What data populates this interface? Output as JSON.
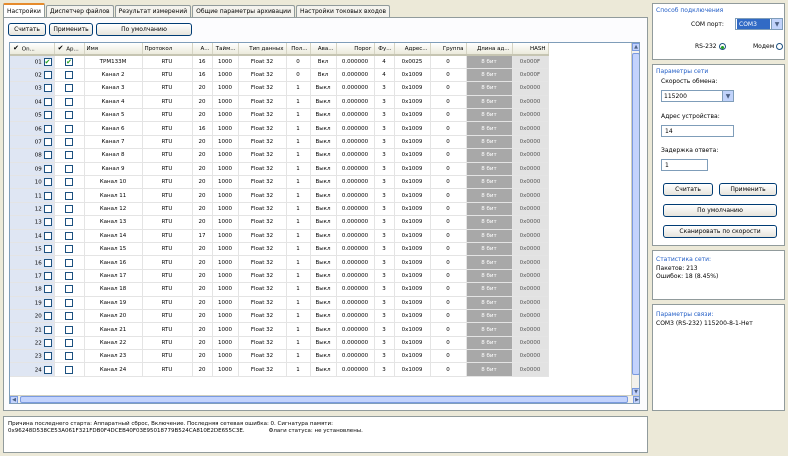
{
  "tabs": [
    {
      "label": "Настройки",
      "active": true
    },
    {
      "label": "Диспетчер файлов",
      "active": false
    },
    {
      "label": "Результат измерений",
      "active": false
    },
    {
      "label": "Общие параметры архивации",
      "active": false
    },
    {
      "label": "Настройки токовых входов",
      "active": false
    }
  ],
  "toolbar": {
    "read_label": "Считать",
    "apply_label": "Применить",
    "default_label": "По умолчанию"
  },
  "columns": [
    "On...",
    "Ар...",
    "Имя",
    "Протокол",
    "А...",
    "Тайм...",
    "Тип данных",
    "Пол...",
    "Ава...",
    "Порог",
    "Фу...",
    "Адрес...",
    "Группа",
    "Длина ад...",
    "HASH"
  ],
  "rows": [
    {
      "n": "01",
      "on": true,
      "ar": true,
      "name": "ТРМ133М",
      "proto": "RTU",
      "a": "16",
      "timeout": "1000",
      "type": "Float 32",
      "pol": "0",
      "ava": "Вкл",
      "thr": "0.000000",
      "fu": "4",
      "addr": "0x0025",
      "grp": "0",
      "len": "8 бит",
      "hash": "0x000F"
    },
    {
      "n": "02",
      "on": false,
      "ar": false,
      "name": "Канал 2",
      "proto": "RTU",
      "a": "16",
      "timeout": "1000",
      "type": "Float 32",
      "pol": "0",
      "ava": "Вкл",
      "thr": "0.000000",
      "fu": "4",
      "addr": "0x1009",
      "grp": "0",
      "len": "8 бит",
      "hash": "0x000F"
    },
    {
      "n": "03",
      "on": false,
      "ar": false,
      "name": "Канал 3",
      "proto": "RTU",
      "a": "20",
      "timeout": "1000",
      "type": "Float 32",
      "pol": "1",
      "ava": "Выкл",
      "thr": "0.000000",
      "fu": "3",
      "addr": "0x1009",
      "grp": "0",
      "len": "8 бит",
      "hash": "0x0000"
    },
    {
      "n": "04",
      "on": false,
      "ar": false,
      "name": "Канал 4",
      "proto": "RTU",
      "a": "20",
      "timeout": "1000",
      "type": "Float 32",
      "pol": "1",
      "ava": "Выкл",
      "thr": "0.000000",
      "fu": "3",
      "addr": "0x1009",
      "grp": "0",
      "len": "8 бит",
      "hash": "0x0000"
    },
    {
      "n": "05",
      "on": false,
      "ar": false,
      "name": "Канал 5",
      "proto": "RTU",
      "a": "20",
      "timeout": "1000",
      "type": "Float 32",
      "pol": "1",
      "ava": "Выкл",
      "thr": "0.000000",
      "fu": "3",
      "addr": "0x1009",
      "grp": "0",
      "len": "8 бит",
      "hash": "0x0000"
    },
    {
      "n": "06",
      "on": false,
      "ar": false,
      "name": "Канал 6",
      "proto": "RTU",
      "a": "16",
      "timeout": "1000",
      "type": "Float 32",
      "pol": "1",
      "ava": "Выкл",
      "thr": "0.000000",
      "fu": "3",
      "addr": "0x1009",
      "grp": "0",
      "len": "8 бит",
      "hash": "0x0000"
    },
    {
      "n": "07",
      "on": false,
      "ar": false,
      "name": "Канал 7",
      "proto": "RTU",
      "a": "20",
      "timeout": "1000",
      "type": "Float 32",
      "pol": "1",
      "ava": "Выкл",
      "thr": "0.000000",
      "fu": "3",
      "addr": "0x1009",
      "grp": "0",
      "len": "8 бит",
      "hash": "0x0000"
    },
    {
      "n": "08",
      "on": false,
      "ar": false,
      "name": "Канал 8",
      "proto": "RTU",
      "a": "20",
      "timeout": "1000",
      "type": "Float 32",
      "pol": "1",
      "ava": "Выкл",
      "thr": "0.000000",
      "fu": "3",
      "addr": "0x1009",
      "grp": "0",
      "len": "8 бит",
      "hash": "0x0000"
    },
    {
      "n": "09",
      "on": false,
      "ar": false,
      "name": "Канал 9",
      "proto": "RTU",
      "a": "20",
      "timeout": "1000",
      "type": "Float 32",
      "pol": "1",
      "ava": "Выкл",
      "thr": "0.000000",
      "fu": "3",
      "addr": "0x1009",
      "grp": "0",
      "len": "8 бит",
      "hash": "0x0000"
    },
    {
      "n": "10",
      "on": false,
      "ar": false,
      "name": "Канал 10",
      "proto": "RTU",
      "a": "20",
      "timeout": "1000",
      "type": "Float 32",
      "pol": "1",
      "ava": "Выкл",
      "thr": "0.000000",
      "fu": "3",
      "addr": "0x1009",
      "grp": "0",
      "len": "8 бит",
      "hash": "0x0000"
    },
    {
      "n": "11",
      "on": false,
      "ar": false,
      "name": "Канал 11",
      "proto": "RTU",
      "a": "20",
      "timeout": "1000",
      "type": "Float 32",
      "pol": "1",
      "ava": "Выкл",
      "thr": "0.000000",
      "fu": "3",
      "addr": "0x1009",
      "grp": "0",
      "len": "8 бит",
      "hash": "0x0000"
    },
    {
      "n": "12",
      "on": false,
      "ar": false,
      "name": "Канал 12",
      "proto": "RTU",
      "a": "20",
      "timeout": "1000",
      "type": "Float 32",
      "pol": "1",
      "ava": "Выкл",
      "thr": "0.000000",
      "fu": "3",
      "addr": "0x1009",
      "grp": "0",
      "len": "8 бит",
      "hash": "0x0000"
    },
    {
      "n": "13",
      "on": false,
      "ar": false,
      "name": "Канал 13",
      "proto": "RTU",
      "a": "20",
      "timeout": "1000",
      "type": "Float 32",
      "pol": "1",
      "ava": "Выкл",
      "thr": "0.000000",
      "fu": "3",
      "addr": "0x1009",
      "grp": "0",
      "len": "8 бит",
      "hash": "0x0000"
    },
    {
      "n": "14",
      "on": false,
      "ar": false,
      "name": "Канал 14",
      "proto": "RTU",
      "a": "17",
      "timeout": "1000",
      "type": "Float 32",
      "pol": "1",
      "ava": "Выкл",
      "thr": "0.000000",
      "fu": "3",
      "addr": "0x1009",
      "grp": "0",
      "len": "8 бит",
      "hash": "0x0000"
    },
    {
      "n": "15",
      "on": false,
      "ar": false,
      "name": "Канал 15",
      "proto": "RTU",
      "a": "20",
      "timeout": "1000",
      "type": "Float 32",
      "pol": "1",
      "ava": "Выкл",
      "thr": "0.000000",
      "fu": "3",
      "addr": "0x1009",
      "grp": "0",
      "len": "8 бит",
      "hash": "0x0000"
    },
    {
      "n": "16",
      "on": false,
      "ar": false,
      "name": "Канал 16",
      "proto": "RTU",
      "a": "20",
      "timeout": "1000",
      "type": "Float 32",
      "pol": "1",
      "ava": "Выкл",
      "thr": "0.000000",
      "fu": "3",
      "addr": "0x1009",
      "grp": "0",
      "len": "8 бит",
      "hash": "0x0000"
    },
    {
      "n": "17",
      "on": false,
      "ar": false,
      "name": "Канал 17",
      "proto": "RTU",
      "a": "20",
      "timeout": "1000",
      "type": "Float 32",
      "pol": "1",
      "ava": "Выкл",
      "thr": "0.000000",
      "fu": "3",
      "addr": "0x1009",
      "grp": "0",
      "len": "8 бит",
      "hash": "0x0000"
    },
    {
      "n": "18",
      "on": false,
      "ar": false,
      "name": "Канал 18",
      "proto": "RTU",
      "a": "20",
      "timeout": "1000",
      "type": "Float 32",
      "pol": "1",
      "ava": "Выкл",
      "thr": "0.000000",
      "fu": "3",
      "addr": "0x1009",
      "grp": "0",
      "len": "8 бит",
      "hash": "0x0000"
    },
    {
      "n": "19",
      "on": false,
      "ar": false,
      "name": "Канал 19",
      "proto": "RTU",
      "a": "20",
      "timeout": "1000",
      "type": "Float 32",
      "pol": "1",
      "ava": "Выкл",
      "thr": "0.000000",
      "fu": "3",
      "addr": "0x1009",
      "grp": "0",
      "len": "8 бит",
      "hash": "0x0000"
    },
    {
      "n": "20",
      "on": false,
      "ar": false,
      "name": "Канал 20",
      "proto": "RTU",
      "a": "20",
      "timeout": "1000",
      "type": "Float 32",
      "pol": "1",
      "ava": "Выкл",
      "thr": "0.000000",
      "fu": "3",
      "addr": "0x1009",
      "grp": "0",
      "len": "8 бит",
      "hash": "0x0000"
    },
    {
      "n": "21",
      "on": false,
      "ar": false,
      "name": "Канал 21",
      "proto": "RTU",
      "a": "20",
      "timeout": "1000",
      "type": "Float 32",
      "pol": "1",
      "ava": "Выкл",
      "thr": "0.000000",
      "fu": "3",
      "addr": "0x1009",
      "grp": "0",
      "len": "8 бит",
      "hash": "0x0000"
    },
    {
      "n": "22",
      "on": false,
      "ar": false,
      "name": "Канал 22",
      "proto": "RTU",
      "a": "20",
      "timeout": "1000",
      "type": "Float 32",
      "pol": "1",
      "ava": "Выкл",
      "thr": "0.000000",
      "fu": "3",
      "addr": "0x1009",
      "grp": "0",
      "len": "8 бит",
      "hash": "0x0000"
    },
    {
      "n": "23",
      "on": false,
      "ar": false,
      "name": "Канал 23",
      "proto": "RTU",
      "a": "20",
      "timeout": "1000",
      "type": "Float 32",
      "pol": "1",
      "ava": "Выкл",
      "thr": "0.000000",
      "fu": "3",
      "addr": "0x1009",
      "grp": "0",
      "len": "8 бит",
      "hash": "0x0000"
    },
    {
      "n": "24",
      "on": false,
      "ar": false,
      "name": "Канал 24",
      "proto": "RTU",
      "a": "20",
      "timeout": "1000",
      "type": "Float 32",
      "pol": "1",
      "ava": "Выкл",
      "thr": "0.000000",
      "fu": "3",
      "addr": "0x1009",
      "grp": "0",
      "len": "8 бит",
      "hash": "0x0000"
    }
  ],
  "status": {
    "line1": "Причина последнего старта: Аппаратный сброс, Включение.  Последняя сетевая ошибка: 0. Сигнатура памяти:",
    "line2": "0x96248D538CE53A061F321FDB0F4DCEB40F03E95018779B524CA810E2DE655C3E.",
    "flags": "Флаги статуса: не установлены."
  },
  "connection": {
    "title": "Способ подключения",
    "com_label": "COM порт:",
    "com_value": "COM3",
    "rs232_label": "RS-232",
    "modem_label": "Модем",
    "rs232_selected": true
  },
  "network": {
    "title": "Параметры сети",
    "speed_label": "Скорость обмена:",
    "speed_value": "115200",
    "addr_label": "Адрес устройства:",
    "addr_value": "14",
    "delay_label": "Задержка ответа:",
    "delay_value": "1",
    "read_label": "Считать",
    "apply_label": "Применить",
    "default_label": "По умолчанию",
    "scan_label": "Сканировать по скорости"
  },
  "stats": {
    "title": "Статистика сети:",
    "packets": "Пакетов: 213",
    "errors": "Ошибок: 18 (8.45%)"
  },
  "link": {
    "title": "Параметры связи:",
    "value": "COM3 (RS-232)  115200-8-1-Нет"
  },
  "colors": {
    "accent": "#215dc6",
    "selection": "#316ac5",
    "tab_highlight": "#e68b2c"
  }
}
